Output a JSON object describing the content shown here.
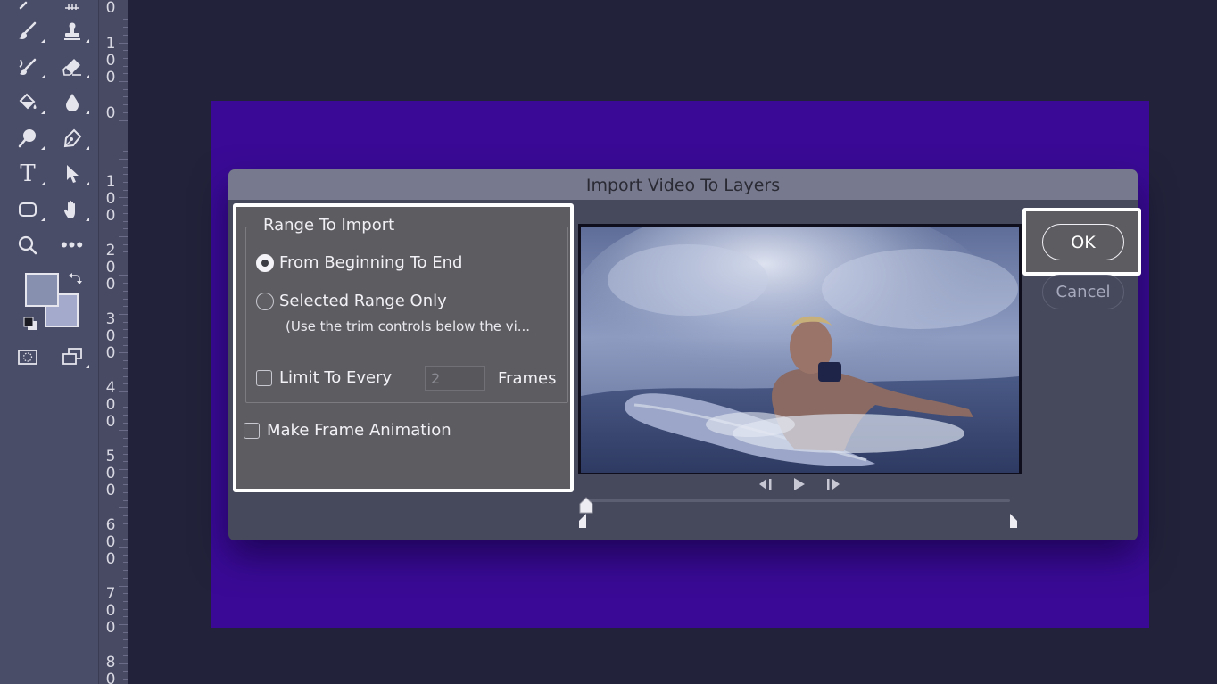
{
  "dialog": {
    "title": "Import Video To Layers",
    "range_to_import": {
      "legend": "Range To Import",
      "options": [
        {
          "label": "From Beginning To End",
          "selected": true
        },
        {
          "label": "Selected Range Only",
          "selected": false
        }
      ],
      "hint": "(Use the trim controls below the vi...",
      "limit_to_every": {
        "label": "Limit To Every",
        "checked": false,
        "value": "2",
        "suffix": "Frames"
      }
    },
    "make_frame_animation": {
      "label": "Make Frame Animation",
      "checked": false
    },
    "buttons": {
      "ok": "OK",
      "cancel": "Cancel"
    },
    "playback": {
      "icons": [
        "step-back-icon",
        "play-icon",
        "step-forward-icon"
      ]
    }
  },
  "ruler": {
    "numbers": [
      [
        "0"
      ],
      [
        "1",
        "0",
        "0"
      ],
      [
        "0"
      ],
      [
        "1",
        "0",
        "0"
      ],
      [
        "2",
        "0",
        "0"
      ],
      [
        "3",
        "0",
        "0"
      ],
      [
        "4",
        "0",
        "0"
      ],
      [
        "5",
        "0",
        "0"
      ],
      [
        "6",
        "0",
        "0"
      ],
      [
        "7",
        "0",
        "0"
      ],
      [
        "8",
        "0"
      ]
    ]
  },
  "toolbar": {
    "tools": [
      "brush-icon",
      "stamp-icon",
      "history-brush-icon",
      "eraser-icon",
      "paint-bucket-icon",
      "blur-drop-icon",
      "dodge-icon",
      "pen-icon",
      "type-icon",
      "selection-arrow-icon",
      "rectangle-icon",
      "hand-icon",
      "zoom-icon",
      "more-tools-icon",
      "quick-mask-icon",
      "screen-mode-icon"
    ]
  },
  "colors": {
    "canvas": "#3a0a96",
    "dialog": "#46485c",
    "panel": "#5d5d61",
    "highlight": "#ffffff",
    "foreground_swatch": "#8890b0",
    "background_swatch": "#a4aacc"
  }
}
